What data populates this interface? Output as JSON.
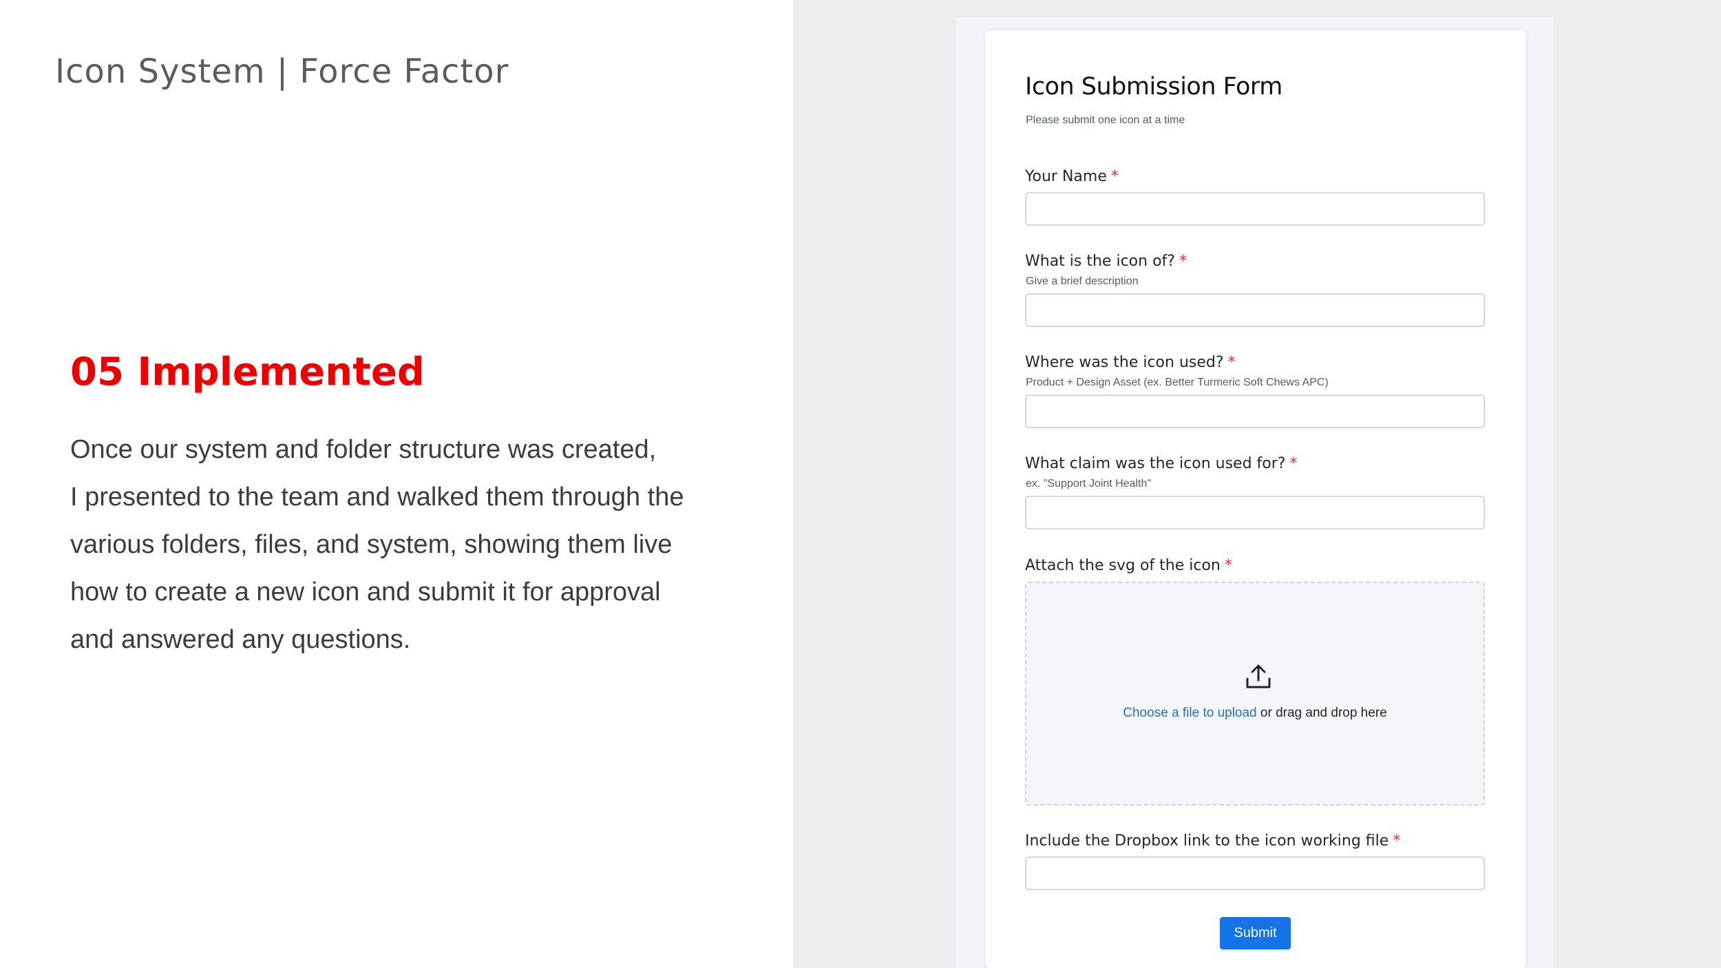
{
  "slide": {
    "title": "Icon System | Force Factor",
    "section_heading": "05 Implemented",
    "body_lines": [
      "Once our system and folder structure was created,",
      "I presented to the team and walked them through the",
      "various folders, files, and system, showing them live",
      "how to create a new icon and submit it for approval",
      "and answered any questions."
    ]
  },
  "form": {
    "title": "Icon Submission Form",
    "subtitle": "Please submit one icon at a time",
    "required_marker": "*",
    "fields": [
      {
        "label": "Your Name",
        "hint": "",
        "value": "",
        "placeholder": ""
      },
      {
        "label": "What is the icon of?",
        "hint": "Give a brief description",
        "value": "",
        "placeholder": ""
      },
      {
        "label": "Where was the icon used?",
        "hint": "Product + Design Asset (ex. Better Turmeric Soft Chews APC)",
        "value": "",
        "placeholder": ""
      },
      {
        "label": "What claim was the icon used for?",
        "hint": "ex. \"Support Joint Health\"",
        "value": "",
        "placeholder": ""
      }
    ],
    "upload": {
      "label": "Attach the svg of the icon",
      "link_text": "Choose a file to upload",
      "rest_text": " or drag and drop here",
      "icon": "upload-icon"
    },
    "dropbox_field": {
      "label": "Include the Dropbox link to the icon working file",
      "value": "",
      "placeholder": ""
    },
    "submit_label": "Submit"
  },
  "colors": {
    "heading_red": "#ee0000",
    "link_blue": "#1f6fc2",
    "button_blue": "#1473e6",
    "required_red": "#e0303a"
  }
}
